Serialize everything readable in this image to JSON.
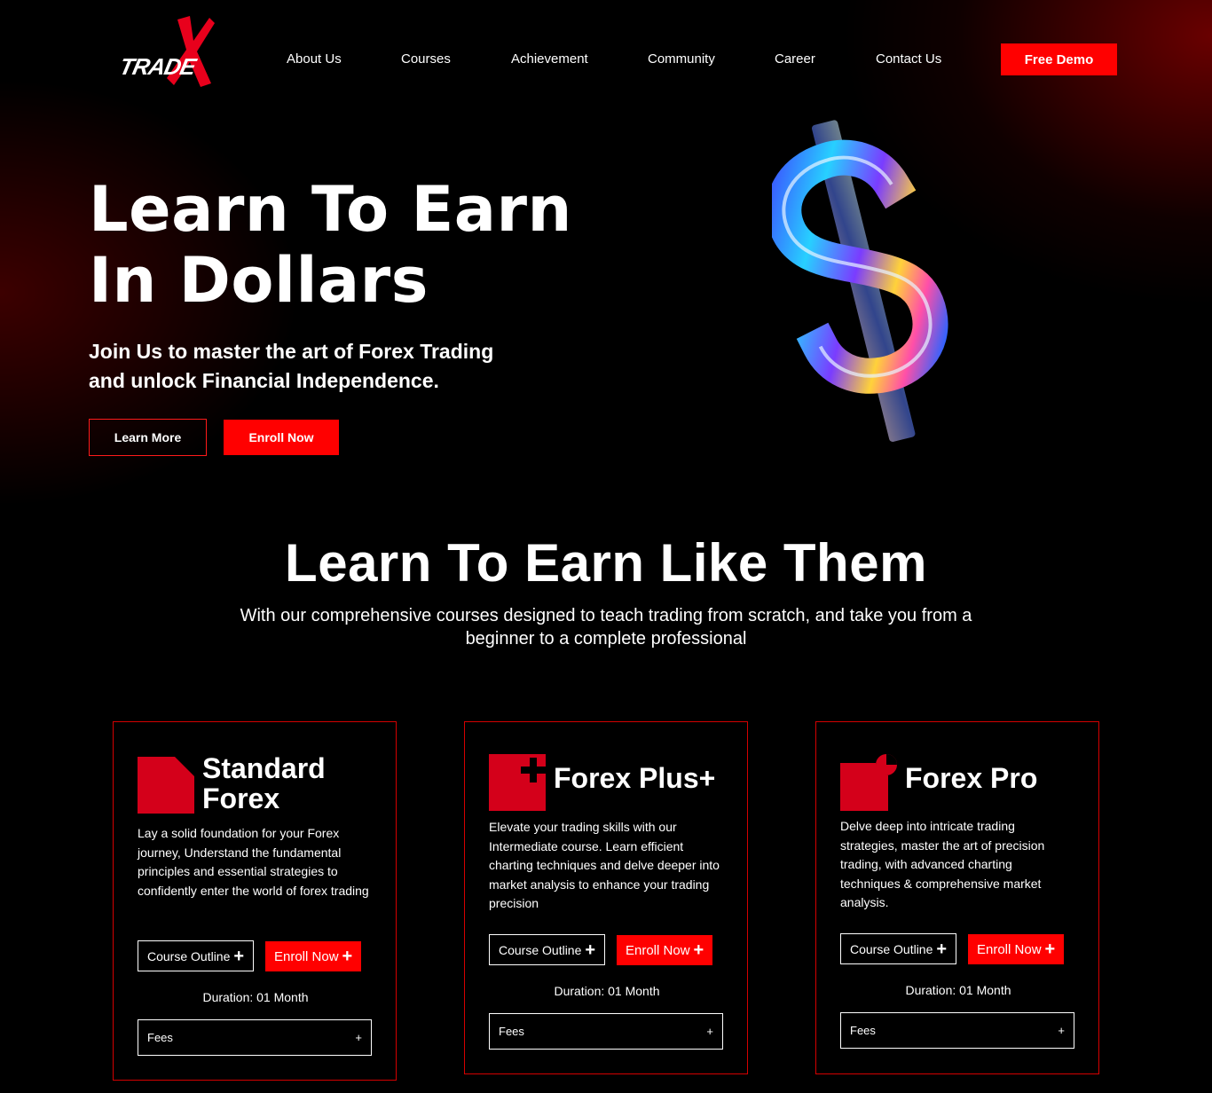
{
  "brand": {
    "logo_text": "TRADE"
  },
  "nav": {
    "links": [
      "About Us",
      "Courses",
      "Achievement",
      "Community",
      "Career",
      "Contact Us"
    ],
    "cta": "Free Demo"
  },
  "hero": {
    "title_line1": "Learn To Earn",
    "title_line2": "In Dollars",
    "subtitle_line1": "Join Us to master the art of Forex Trading",
    "subtitle_line2": "and unlock Financial Independence.",
    "learn_more": "Learn More",
    "enroll_now": "Enroll Now"
  },
  "courses_section": {
    "title": "Learn To Earn Like Them",
    "description": "With our comprehensive courses designed to teach trading from scratch, and take you from a beginner to a complete professional"
  },
  "cards": [
    {
      "title_line1": "Standard",
      "title_line2": "Forex",
      "description": "Lay a solid foundation for your Forex journey, Understand the fundamental principles and essential strategies to confidently enter the world of forex trading",
      "course_outline": "Course Outline",
      "enroll": "Enroll Now",
      "duration": "Duration: 01 Month",
      "fees": "Fees",
      "fees_toggle": "+"
    },
    {
      "title": "Forex Plus+",
      "description": "Elevate your trading skills with our Intermediate course. Learn efficient charting techniques and delve deeper into market analysis to enhance your trading precision",
      "course_outline": "Course Outline",
      "enroll": "Enroll Now",
      "duration": "Duration: 01 Month",
      "fees": "Fees",
      "fees_toggle": "+"
    },
    {
      "title": "Forex Pro",
      "description": "Delve deep into intricate trading strategies, master the art of precision trading, with advanced charting techniques & comprehensive market analysis.",
      "course_outline": "Course Outline",
      "enroll": "Enroll Now",
      "duration": "Duration: 01 Month",
      "fees": "Fees",
      "fees_toggle": "+"
    }
  ],
  "colors": {
    "accent": "#ff0000",
    "card_border": "#d40000",
    "icon_red": "#d4001a",
    "background": "#000000"
  }
}
